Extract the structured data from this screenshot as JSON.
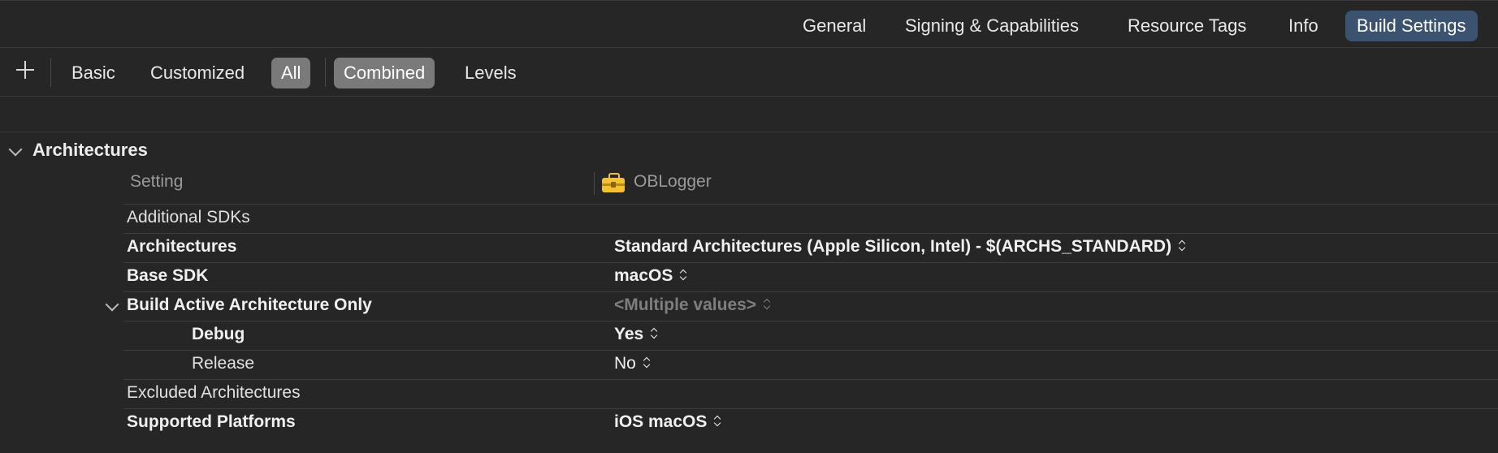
{
  "tabs": [
    {
      "label": "General",
      "active": false
    },
    {
      "label": "Signing & Capabilities",
      "active": false
    },
    {
      "label": "Resource Tags",
      "active": false
    },
    {
      "label": "Info",
      "active": false
    },
    {
      "label": "Build Settings",
      "active": true
    }
  ],
  "filters": {
    "scope": [
      {
        "label": "Basic",
        "selected": false
      },
      {
        "label": "Customized",
        "selected": false
      },
      {
        "label": "All",
        "selected": true
      }
    ],
    "view": [
      {
        "label": "Combined",
        "selected": true
      },
      {
        "label": "Levels",
        "selected": false
      }
    ]
  },
  "section": {
    "title": "Architectures",
    "expanded": true
  },
  "columns": {
    "setting": "Setting",
    "target": "OBLogger",
    "target_icon": "toolbox-icon"
  },
  "rows": [
    {
      "name": "Additional SDKs",
      "value": "",
      "bold": false
    },
    {
      "name": "Architectures",
      "value": "Standard Architectures (Apple Silicon, Intel)  -  $(ARCHS_STANDARD)",
      "bold": true,
      "stepper": true
    },
    {
      "name": "Base SDK",
      "value": "macOS",
      "bold": true,
      "stepper": true
    },
    {
      "name": "Build Active Architecture Only",
      "value": "<Multiple values>",
      "bold": true,
      "stepper": true,
      "muted": true,
      "expanded": true
    },
    {
      "name": "Debug",
      "value": "Yes",
      "bold": true,
      "stepper": true,
      "sub": true
    },
    {
      "name": "Release",
      "value": "No",
      "bold": false,
      "stepper": true,
      "sub": true
    },
    {
      "name": "Excluded Architectures",
      "value": "",
      "bold": false
    },
    {
      "name": "Supported Platforms",
      "value": "iOS macOS",
      "bold": true,
      "stepper": true
    }
  ],
  "colors": {
    "background": "#262626",
    "active_tab": "#3b5270",
    "selected_filter": "#7a7a7a",
    "target_icon": "#f2c230"
  }
}
